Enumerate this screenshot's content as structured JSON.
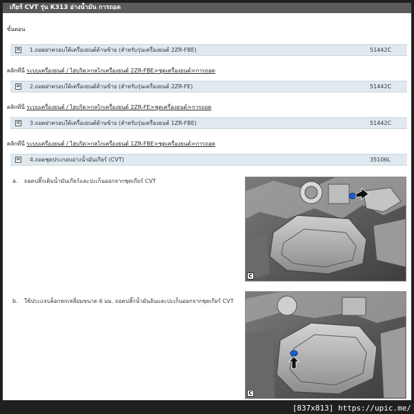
{
  "header": {
    "title": "เกียร์ CVT รุ่น K313  อ่างน้ำมัน  การถอด"
  },
  "steps_heading": "ขั้นตอน",
  "steps": [
    {
      "label": "1.ถอดฝาครอบใต้เครื่องยนต์ด้านซ้าย (สำหรับรุ่นเครื่องยนต์ 2ZR-FBE)",
      "code": "51442C"
    },
    {
      "label": "2.ถอดฝาครอบใต้เครื่องยนต์ด้านซ้าย (สำหรับรุ่นเครื่องยนต์ 2ZR-FE)",
      "code": "51442C"
    },
    {
      "label": "3.ถอดฝาครอบใต้เครื่องยนต์ด้านซ้าย (สำหรับรุ่นเครื่องยนต์ 1ZR-FBE)",
      "code": "51442C"
    },
    {
      "label": "4.ถอดชุดประกอบอ่างน้ำมันเกียร์ (CVT)",
      "code": "35106L"
    }
  ],
  "refs": [
    {
      "prefix": "คลิกที่นี่",
      "link": "ระบบเครื่องยนต์ / ไฮบริด>กลไกเครื่องยนต์ 2ZR-FBE>ชุดเครื่องยนต์>การถอด"
    },
    {
      "prefix": "คลิกที่นี่",
      "link": "ระบบเครื่องยนต์ / ไฮบริด>กลไกเครื่องยนต์ 2ZR-FE>ชุดเครื่องยนต์>การถอด"
    },
    {
      "prefix": "คลิกที่นี่",
      "link": "ระบบเครื่องยนต์ / ไฮบริด>กลไกเครื่องยนต์ 1ZR-FBE>ชุดเครื่องยนต์>การถอด"
    }
  ],
  "instructions": [
    {
      "marker": "a.",
      "text": "ถอดปลั๊กเติมน้ำมันเกียร์และปะเก็นออกจากชุดเกียร์ CVT",
      "figure_label": "C"
    },
    {
      "marker": "b.",
      "text": "ใช้ประแจบล็อกหกเหลี่ยมขนาด 6 มม. ถอดปลั๊กน้ำมันล้นและปะเก็นออกจากชุดเกียร์ CVT",
      "figure_label": "C"
    }
  ],
  "watermark": "[837x813] https://upic.me/",
  "colors": {
    "title_bar": "#5b5b5b",
    "step_bar": "#dfe9ef",
    "highlight": "#1a5fd6"
  },
  "icons": {
    "step_toggle": "minus-square-icon",
    "pointer": "arrow-icon"
  }
}
